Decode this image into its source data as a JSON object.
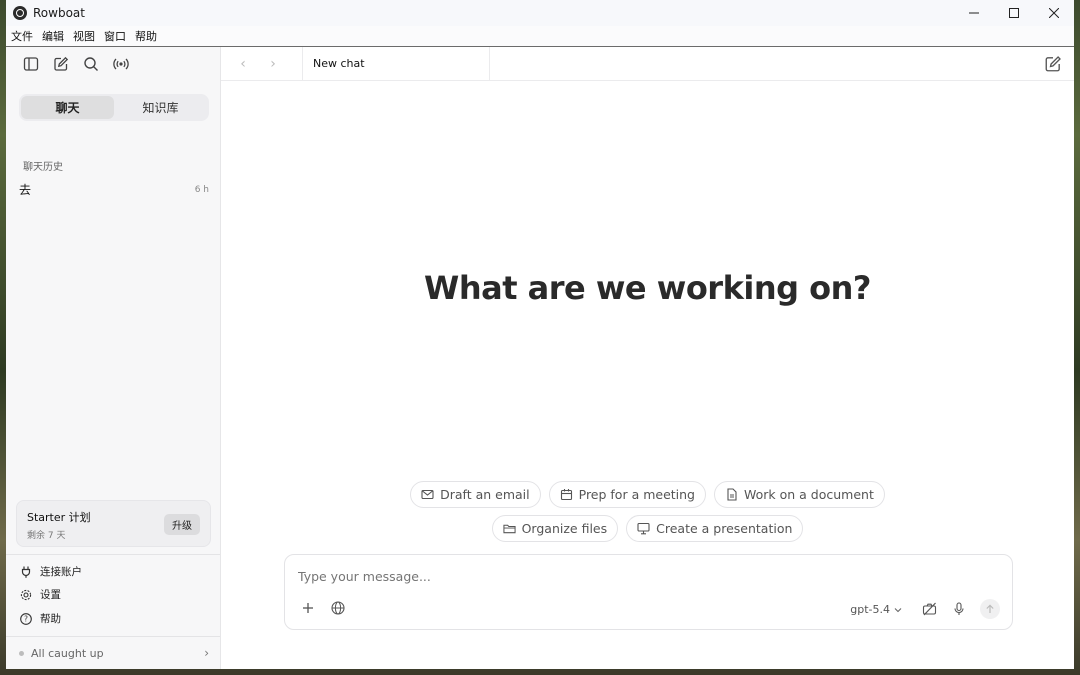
{
  "window": {
    "title": "Rowboat",
    "controls": {
      "minimize": "—",
      "maximize": "☐",
      "close": "✕"
    }
  },
  "menu": [
    "文件",
    "编辑",
    "视图",
    "窗口",
    "帮助"
  ],
  "sidebar": {
    "segments": [
      {
        "label": "聊天",
        "active": true
      },
      {
        "label": "知识库",
        "active": false
      }
    ],
    "history_heading": "聊天历史",
    "history": [
      {
        "title": "去",
        "time": "6 h"
      }
    ],
    "plan": {
      "name": "Starter 计划",
      "remaining": "剩余 7 天",
      "upgrade_label": "升级"
    },
    "links": [
      {
        "label": "连接账户",
        "icon": "plug-icon"
      },
      {
        "label": "设置",
        "icon": "gear-icon"
      },
      {
        "label": "帮助",
        "icon": "help-icon"
      }
    ],
    "status": {
      "text": "All caught up"
    }
  },
  "tabs": [
    {
      "label": "New chat"
    }
  ],
  "main": {
    "heading": "What are we working on?",
    "suggestions": [
      {
        "label": "Draft an email",
        "icon": "mail-icon"
      },
      {
        "label": "Prep for a meeting",
        "icon": "calendar-icon"
      },
      {
        "label": "Work on a document",
        "icon": "document-icon"
      },
      {
        "label": "Organize files",
        "icon": "folder-icon"
      },
      {
        "label": "Create a presentation",
        "icon": "presentation-icon"
      }
    ],
    "composer": {
      "placeholder": "Type your message...",
      "model": "gpt-5.4"
    }
  }
}
